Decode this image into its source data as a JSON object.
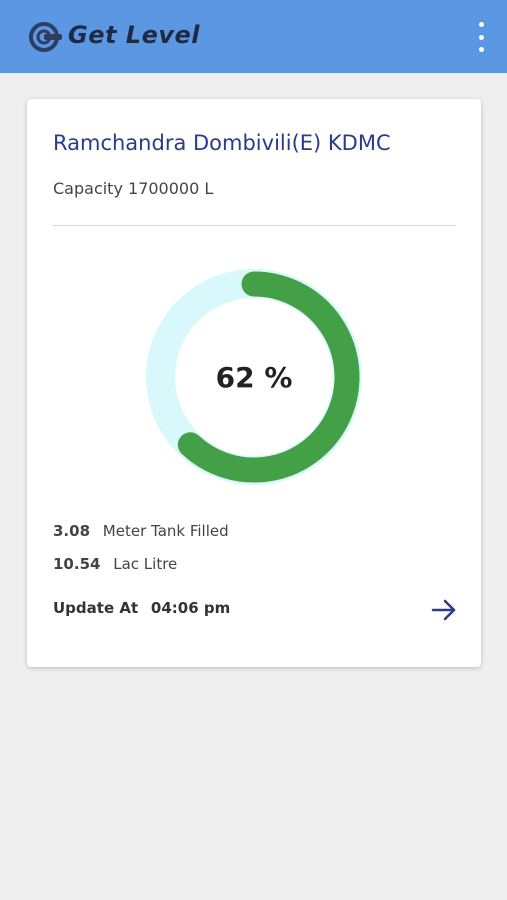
{
  "app": {
    "title": "Get Level",
    "menu_icon": "more-vert-icon",
    "logo_icon": "gauge-logo-icon"
  },
  "card": {
    "station_name": "Ramchandra Dombivili(E) KDMC",
    "capacity_label": "Capacity",
    "capacity_value": "1700000 L",
    "gauge": {
      "percent_text": "62 %",
      "fill_fraction": 0.62,
      "fill_color": "#43a047",
      "track_color": "#d9f8fc"
    },
    "stats": [
      {
        "value": "3.08",
        "label": "Meter Tank Filled"
      },
      {
        "value": "10.54",
        "label": "Lac Litre"
      }
    ],
    "update_label": "Update At",
    "update_time": "04:06 pm",
    "arrow_icon": "arrow-forward-icon"
  },
  "colors": {
    "appbar": "#5b97e3",
    "accent_text": "#2b3a8c"
  }
}
